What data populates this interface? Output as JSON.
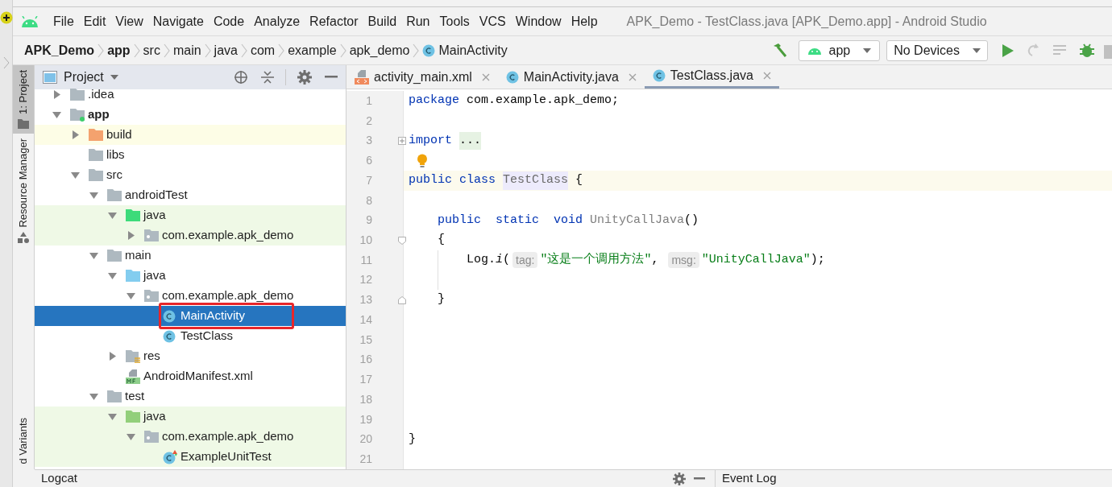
{
  "menu_bar": {
    "items": [
      {
        "label": "File"
      },
      {
        "label": "Edit"
      },
      {
        "label": "View"
      },
      {
        "label": "Navigate"
      },
      {
        "label": "Code"
      },
      {
        "label": "Analyze"
      },
      {
        "label": "Refactor"
      },
      {
        "label": "Build"
      },
      {
        "label": "Run"
      },
      {
        "label": "Tools"
      },
      {
        "label": "VCS"
      },
      {
        "label": "Window"
      },
      {
        "label": "Help"
      }
    ],
    "title": "APK_Demo - TestClass.java [APK_Demo.app] - Android Studio"
  },
  "breadcrumbs": [
    {
      "label": "APK_Demo",
      "kind": "project"
    },
    {
      "label": "app",
      "kind": "module"
    },
    {
      "label": "src",
      "kind": "folder"
    },
    {
      "label": "main",
      "kind": "folder"
    },
    {
      "label": "java",
      "kind": "folder"
    },
    {
      "label": "com",
      "kind": "folder"
    },
    {
      "label": "example",
      "kind": "folder"
    },
    {
      "label": "apk_demo",
      "kind": "folder"
    },
    {
      "label": "MainActivity",
      "kind": "class"
    }
  ],
  "toolbar": {
    "configuration": "app",
    "device": "No Devices"
  },
  "side_stripe": [
    {
      "label": "1: Project",
      "selected": true
    },
    {
      "label": "Resource Manager",
      "selected": false
    },
    {
      "label": "d Variants",
      "selected": false
    }
  ],
  "project_panel": {
    "title": "Project",
    "tree": [
      {
        "label": ".idea",
        "kind": "folder",
        "expanded": false
      },
      {
        "label": "app",
        "kind": "module",
        "expanded": true,
        "children": [
          {
            "label": "build",
            "kind": "excluded-folder",
            "expanded": false,
            "excluded": true
          },
          {
            "label": "libs",
            "kind": "folder"
          },
          {
            "label": "src",
            "kind": "folder",
            "expanded": true,
            "children": [
              {
                "label": "androidTest",
                "kind": "folder",
                "expanded": true,
                "children": [
                  {
                    "label": "java",
                    "kind": "test-root",
                    "expanded": true,
                    "test": true,
                    "children": [
                      {
                        "label": "com.example.apk_demo",
                        "kind": "package",
                        "expanded": false,
                        "test": true
                      }
                    ]
                  }
                ]
              },
              {
                "label": "main",
                "kind": "folder",
                "expanded": true,
                "children": [
                  {
                    "label": "java",
                    "kind": "source-root",
                    "expanded": true,
                    "children": [
                      {
                        "label": "com.example.apk_demo",
                        "kind": "package",
                        "expanded": true,
                        "children": [
                          {
                            "label": "MainActivity",
                            "kind": "class",
                            "selected": true,
                            "annotated": true
                          },
                          {
                            "label": "TestClass",
                            "kind": "class",
                            "selected": false
                          }
                        ]
                      }
                    ]
                  },
                  {
                    "label": "res",
                    "kind": "res",
                    "expanded": false
                  },
                  {
                    "label": "AndroidManifest.xml",
                    "kind": "manifest"
                  }
                ]
              },
              {
                "label": "test",
                "kind": "folder",
                "expanded": true,
                "children": [
                  {
                    "label": "java",
                    "kind": "test-root-alt",
                    "expanded": true,
                    "test": true,
                    "children": [
                      {
                        "label": "com.example.apk_demo",
                        "kind": "package",
                        "expanded": true,
                        "test": true,
                        "children": [
                          {
                            "label": "ExampleUnitTest",
                            "kind": "test-class",
                            "test": true
                          }
                        ]
                      }
                    ]
                  }
                ]
              }
            ]
          }
        ]
      }
    ]
  },
  "editor_tabs": [
    {
      "label": "activity_main.xml",
      "kind": "xml",
      "selected": false
    },
    {
      "label": "MainActivity.java",
      "kind": "class",
      "selected": false
    },
    {
      "label": "TestClass.java",
      "kind": "class",
      "selected": true
    }
  ],
  "code_lines": [
    {
      "number": "1",
      "kind": "plain",
      "tokens": [
        {
          "kind": "keyword",
          "text": "package"
        },
        {
          "kind": "plain",
          "text": " com.example.apk_demo;"
        }
      ]
    },
    {
      "number": "2",
      "kind": "plain"
    },
    {
      "number": "3",
      "kind": "fold-collapsed",
      "tokens": [
        {
          "kind": "keyword",
          "text": "import "
        },
        {
          "kind": "folded",
          "text": "..."
        }
      ]
    },
    {
      "number": "6",
      "kind": "bulb"
    },
    {
      "number": "7",
      "kind": "plain",
      "current": true,
      "tokens": [
        {
          "kind": "keyword",
          "text": "public class "
        },
        {
          "kind": "highlighted",
          "text": "TestClass"
        },
        {
          "kind": "plain",
          "text": " {"
        }
      ]
    },
    {
      "number": "8",
      "kind": "plain"
    },
    {
      "number": "9",
      "kind": "plain",
      "tokens": [
        {
          "kind": "keyword",
          "text": "    public  static  void "
        },
        {
          "kind": "unused",
          "text": "UnityCallJava"
        },
        {
          "kind": "plain",
          "text": "()"
        }
      ]
    },
    {
      "number": "10",
      "kind": "fold-open",
      "tokens": [
        {
          "kind": "plain",
          "text": "    {"
        }
      ]
    },
    {
      "number": "11",
      "kind": "plain",
      "guide": true,
      "tokens": [
        {
          "kind": "plain",
          "text": "        Log."
        },
        {
          "kind": "static",
          "text": "i"
        },
        {
          "kind": "plain",
          "text": "("
        },
        {
          "kind": "hint",
          "text": "tag:"
        },
        {
          "kind": "string",
          "text": "\"这是一个调用方法\""
        },
        {
          "kind": "plain",
          "text": ", "
        },
        {
          "kind": "hint",
          "text": "msg:"
        },
        {
          "kind": "string",
          "text": "\"UnityCallJava\""
        },
        {
          "kind": "plain",
          "text": ");"
        }
      ]
    },
    {
      "number": "12",
      "kind": "plain",
      "guide": true
    },
    {
      "number": "13",
      "kind": "fold-close",
      "tokens": [
        {
          "kind": "plain",
          "text": "    }"
        }
      ]
    },
    {
      "number": "14",
      "kind": "plain"
    },
    {
      "number": "15",
      "kind": "plain"
    },
    {
      "number": "16",
      "kind": "plain"
    },
    {
      "number": "17",
      "kind": "plain"
    },
    {
      "number": "18",
      "kind": "plain"
    },
    {
      "number": "19",
      "kind": "plain"
    },
    {
      "number": "20",
      "kind": "plain",
      "tokens": [
        {
          "kind": "plain",
          "text": "}"
        }
      ]
    },
    {
      "number": "21",
      "kind": "plain"
    }
  ],
  "bottom_panels": [
    {
      "title": "Logcat"
    },
    {
      "title": "Event Log"
    }
  ]
}
